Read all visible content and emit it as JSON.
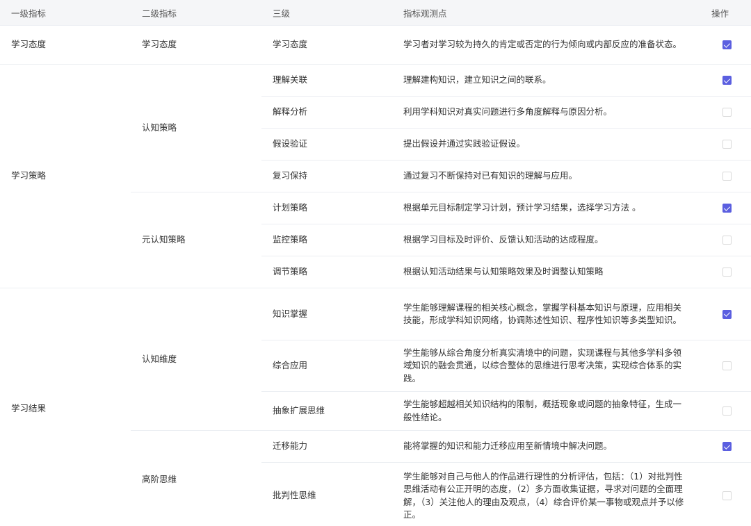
{
  "header": {
    "col1": "一级指标",
    "col2": "二级指标",
    "col3": "三级",
    "col4": "指标观测点",
    "col5": "操作"
  },
  "level1": {
    "attitude": "学习态度",
    "strategy": "学习策略",
    "result": "学习结果"
  },
  "level2": {
    "attitude": "学习态度",
    "cognitive_strategy": "认知策略",
    "metacognitive_strategy": "元认知策略",
    "cognitive_dimension": "认知维度",
    "higher_order": "高阶思维"
  },
  "rows": [
    {
      "level3": "学习态度",
      "description": "学习者对学习较为持久的肯定或否定的行为倾向或内部反应的准备状态。",
      "checked": true
    },
    {
      "level3": "理解关联",
      "description": "理解建构知识，建立知识之间的联系。",
      "checked": true
    },
    {
      "level3": "解释分析",
      "description": "利用学科知识对真实问题进行多角度解释与原因分析。",
      "checked": false
    },
    {
      "level3": "假设验证",
      "description": "提出假设并通过实践验证假设。",
      "checked": false
    },
    {
      "level3": "复习保持",
      "description": "通过复习不断保持对已有知识的理解与应用。",
      "checked": false
    },
    {
      "level3": "计划策略",
      "description": "根据单元目标制定学习计划，预计学习结果，选择学习方法 。",
      "checked": true
    },
    {
      "level3": "监控策略",
      "description": "根据学习目标及时评价、反馈认知活动的达成程度。",
      "checked": false
    },
    {
      "level3": "调节策略",
      "description": "根据认知活动结果与认知策略效果及时调整认知策略",
      "checked": false
    },
    {
      "level3": "知识掌握",
      "description": "学生能够理解课程的相关核心概念，掌握学科基本知识与原理，应用相关技能，形成学科知识网络，协调陈述性知识、程序性知识等多类型知识。",
      "checked": true
    },
    {
      "level3": "综合应用",
      "description": "学生能够从综合角度分析真实清境中的问题，实现课程与其他多学科多领域知识的融会贯通，以综合整体的思维进行思考决策，实现综合体系的实践。",
      "checked": false
    },
    {
      "level3": "抽象扩展思维",
      "description": "学生能够超越相关知识结构的限制，概括现象或问题的抽象特征，生成一般性结论。",
      "checked": false
    },
    {
      "level3": "迁移能力",
      "description": "能将掌握的知识和能力迁移应用至新情境中解决问题。",
      "checked": true
    },
    {
      "level3": "批判性思维",
      "description": "学生能够对自己与他人的作品进行理性的分析评估，包括：（1）对批判性思维活动有公正开明的态度，（2）多方面收集证据，寻求对问题的全面理解，（3）关注他人的理由及观点，（4）综合评价某一事物或观点并予以修正。",
      "checked": false
    }
  ],
  "colors": {
    "accent": "#5b5fe0",
    "header_bg": "#f5f6f8",
    "border": "#ebeef2"
  }
}
